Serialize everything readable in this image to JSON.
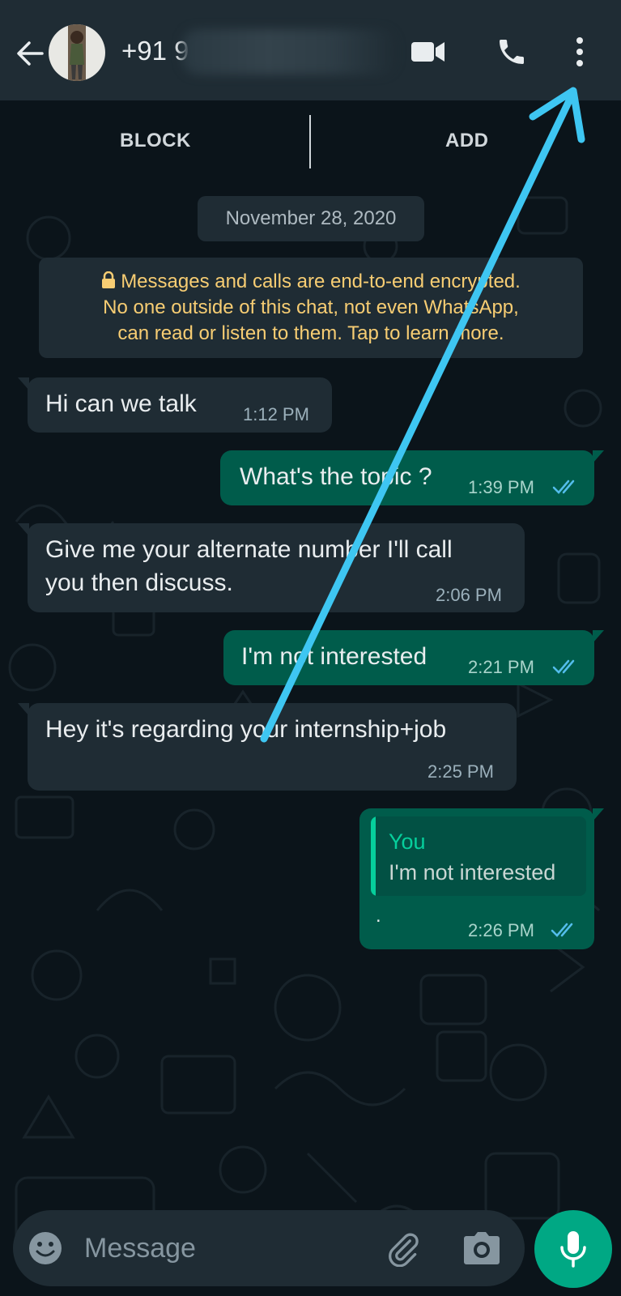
{
  "header": {
    "contact_number": "+91 9",
    "back_icon": "arrow-left-icon",
    "video_icon": "video-camera-icon",
    "call_icon": "phone-icon",
    "menu_icon": "vertical-dots-icon"
  },
  "actions": {
    "block_label": "BLOCK",
    "add_label": "ADD"
  },
  "date_chip": "November 28, 2020",
  "encryption_notice": {
    "line1": "Messages and calls are end-to-end encrypted.",
    "line2": "No one outside of this chat, not even WhatsApp,",
    "line3": "can read or listen to them. Tap to learn more."
  },
  "messages": [
    {
      "direction": "incoming",
      "text": "Hi can we talk",
      "time": "1:12 PM"
    },
    {
      "direction": "outgoing",
      "text": "What's the topic ?",
      "time": "1:39 PM",
      "status": "read"
    },
    {
      "direction": "incoming",
      "line1": "Give me your alternate number I'll call",
      "line2": "you then discuss.",
      "time": "2:06 PM"
    },
    {
      "direction": "outgoing",
      "text": "I'm not interested",
      "time": "2:21 PM",
      "status": "read"
    },
    {
      "direction": "incoming",
      "text": "Hey it's regarding your internship+job",
      "time": "2:25 PM"
    },
    {
      "direction": "outgoing",
      "quote_author": "You",
      "quote_text": "I'm not interested",
      "text": ".",
      "time": "2:26 PM",
      "status": "read"
    }
  ],
  "composer": {
    "placeholder": "Message",
    "emoji_icon": "emoji-icon",
    "attach_icon": "paperclip-icon",
    "camera_icon": "camera-icon",
    "mic_icon": "microphone-icon"
  },
  "colors": {
    "header_bg": "#1f2c34",
    "chat_bg": "#0b141a",
    "incoming_bubble": "#1f2c34",
    "outgoing_bubble": "#005c4b",
    "accent": "#00a884",
    "read_ticks": "#53bdeb",
    "encryption_text": "#f7cd73",
    "annotation_arrow": "#3ec6f2"
  }
}
